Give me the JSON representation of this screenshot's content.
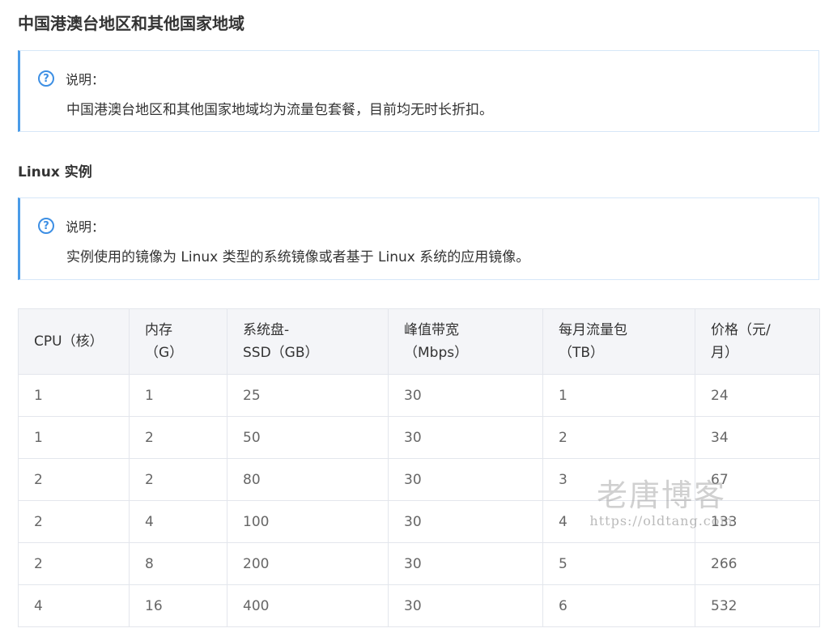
{
  "page": {
    "title": "中国港澳台地区和其他国家地域"
  },
  "note_region": {
    "label": "说明：",
    "text": "中国港澳台地区和其他国家地域均为流量包套餐，目前均无时长折扣。"
  },
  "section": {
    "title": "Linux 实例"
  },
  "note_linux": {
    "label": "说明：",
    "text": "实例使用的镜像为 Linux 类型的系统镜像或者基于 Linux 系统的应用镜像。"
  },
  "colors": {
    "accent": "#4a9be8",
    "icon": "#3d8fe4",
    "header_bg": "#f4f5f8",
    "border": "#e3e6ec"
  },
  "icons": {
    "help": "question-circle"
  },
  "table": {
    "headers": [
      [
        "CPU（核）"
      ],
      [
        "内存",
        "（G）"
      ],
      [
        "系统盘-",
        "SSD（GB）"
      ],
      [
        "峰值带宽",
        "（Mbps）"
      ],
      [
        "每月流量包",
        "（TB）"
      ],
      [
        "价格（元/",
        "月）"
      ]
    ],
    "rows": [
      [
        "1",
        "1",
        "25",
        "30",
        "1",
        "24"
      ],
      [
        "1",
        "2",
        "50",
        "30",
        "2",
        "34"
      ],
      [
        "2",
        "2",
        "80",
        "30",
        "3",
        "67"
      ],
      [
        "2",
        "4",
        "100",
        "30",
        "4",
        "133"
      ],
      [
        "2",
        "8",
        "200",
        "30",
        "5",
        "266"
      ],
      [
        "4",
        "16",
        "400",
        "30",
        "6",
        "532"
      ]
    ]
  },
  "watermark": {
    "title": "老唐博客",
    "url": "https://oldtang.com"
  }
}
